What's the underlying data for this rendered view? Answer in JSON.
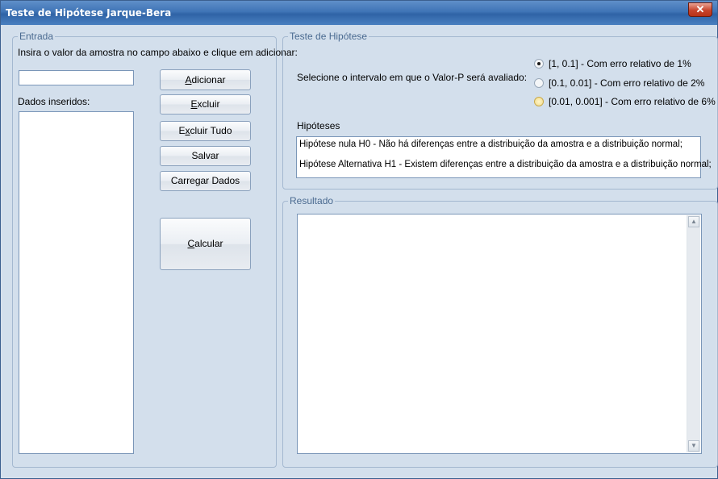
{
  "window": {
    "title": "Teste de Hipótese Jarque-Bera",
    "close_glyph": "✕"
  },
  "entrada": {
    "legend": "Entrada",
    "instruction": "Insira o valor da amostra no campo abaixo e clique em adicionar:",
    "input_value": "",
    "data_label": "Dados inseridos:",
    "buttons": {
      "adicionar": {
        "mnemonic": "A",
        "rest": "dicionar"
      },
      "excluir": {
        "mnemonic": "E",
        "rest": "xcluir"
      },
      "excluir_tudo": {
        "pre": "E",
        "mnemonic": "x",
        "rest": "cluir Tudo"
      },
      "salvar": "Salvar",
      "carregar": "Carregar Dados",
      "calcular": {
        "mnemonic": "C",
        "rest": "alcular"
      }
    }
  },
  "teste": {
    "legend": "Teste de Hipótese",
    "prompt": "Selecione o intervalo em que o Valor-P será avaliado:",
    "options": [
      {
        "label": "[1, 0.1]  - Com erro relativo de 1%",
        "checked": true
      },
      {
        "label": "[0.1, 0.01]  - Com erro relativo de 2%",
        "checked": false
      },
      {
        "label": "[0.01, 0.001] - Com erro relativo de 6%",
        "checked": false
      }
    ],
    "hipoteses_label": "Hipóteses",
    "h0": "Hipótese nula H0 - Não há diferenças entre a distribuição da amostra e  a distribuição normal;",
    "h1": "Hipótese Alternativa H1 - Existem diferenças entre a distribuição da amostra e  a distribuição normal;"
  },
  "resultado": {
    "legend": "Resultado",
    "text": ""
  },
  "icons": {
    "scroll_up": "▲",
    "scroll_down": "▼"
  }
}
